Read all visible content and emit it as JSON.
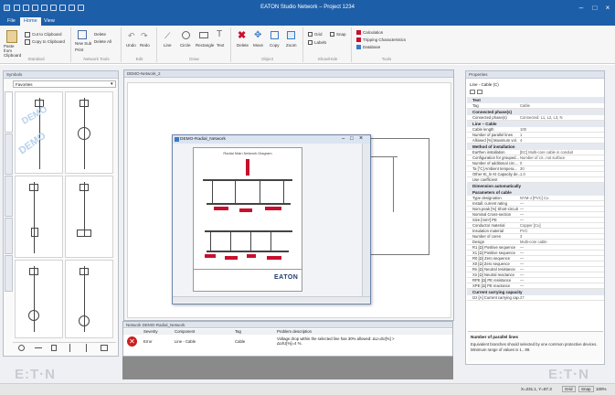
{
  "window": {
    "title": "EATON Studio Network – Project 1234"
  },
  "menu_tabs": [
    "File",
    "Home",
    "View"
  ],
  "ribbon": {
    "groups": [
      {
        "label": "Standard",
        "buttons": [
          "Paste from Clipboard",
          "Cut to Clipboard",
          "Copy to Clipboard"
        ]
      },
      {
        "label": "Network Tools",
        "buttons": [
          "New Sub",
          "Print",
          "Delete",
          "Delete All"
        ]
      },
      {
        "label": "Edit",
        "buttons": [
          "Undo",
          "Redo"
        ]
      },
      {
        "label": "Draw",
        "buttons": [
          "Line",
          "Circle",
          "Rectangle",
          "Text"
        ]
      },
      {
        "label": "Object",
        "buttons": [
          "Delete",
          "Move",
          "Copy",
          "Zoom"
        ]
      },
      {
        "label": "Show/Hide",
        "buttons": [
          "Grid",
          "Snap",
          "Labels"
        ]
      },
      {
        "label": "Tools",
        "buttons": [
          "Calculation",
          "Tripping Characteristics",
          "Database"
        ]
      }
    ]
  },
  "symbols_panel": {
    "title": "Symbols",
    "dropdown": "Favorites",
    "side_tabs": [
      "Favourites",
      "Symbols",
      "Protection",
      "Distribution",
      "Selectivity"
    ]
  },
  "overlays": {
    "demo": "DEMO"
  },
  "watermark": "E:T·N",
  "network_window": {
    "title": "DEMO-Radial_Network",
    "heading": "Radial Main Network Diagram",
    "brand": "EATON"
  },
  "background_window": {
    "title": "DEMO-Network_2"
  },
  "error_panel": {
    "title": "Network DEMO-Radial_Network",
    "columns": [
      "Severity",
      "Component",
      "Tag",
      "Problem description"
    ],
    "rows": [
      {
        "severity": "Error",
        "component": "Line - Cable",
        "tag": "Cable",
        "problem": "Voltage drop within the selected line has 30% allowed: ΔU=dU[%] > ΔU/U[%]=4 %."
      }
    ]
  },
  "properties": {
    "title": "Properties",
    "object": "Line - Cable (C)",
    "categories": [
      {
        "name": "Text",
        "rows": [
          [
            "Tag",
            "Cable"
          ]
        ]
      },
      {
        "name": "Connected phase(s)",
        "rows": [
          [
            "Connected phase(s)",
            "Connected: L1, L2, L3, N"
          ]
        ]
      },
      {
        "name": "Line – Cable",
        "rows": [
          [
            "Cable length",
            "100"
          ],
          [
            "Number of parallel lines",
            "1"
          ],
          [
            "Allowed [%] Maximum vol.",
            "4"
          ]
        ]
      },
      {
        "name": "Method of installation",
        "rows": [
          [
            "Earthen installation",
            "[EC] Multi-core cable in conduit"
          ],
          [
            "Configuration for grouped...",
            "Number of cir...not surface"
          ],
          [
            "Number of additional circ...",
            "0"
          ],
          [
            "Ta [°C] Ambient tempera...",
            "30"
          ],
          [
            "Other Kt_ln Kt Capacity de...",
            "1.0"
          ],
          [
            "Use coefficient",
            ""
          ]
        ]
      },
      {
        "name": "Dimension automatically",
        "rows": []
      },
      {
        "name": "Parameters of cable",
        "rows": [
          [
            "Type designation",
            "NYM-J [PVC] Cu"
          ],
          [
            "Install. current rating",
            "—"
          ],
          [
            "Nom.peak [%] Short-circuit",
            "—"
          ],
          [
            "Nominal Cross-section",
            "—"
          ],
          [
            "Size [mm²] PE",
            "—"
          ],
          [
            "Conductor material",
            "Copper [Cu]"
          ],
          [
            "Insulation material",
            "PVC"
          ],
          [
            "Number of cores",
            "3"
          ],
          [
            "Design",
            "Multi-core cable"
          ],
          [
            "R1 [Ω] Positive sequence",
            "—"
          ],
          [
            "X1 [Ω] Positive sequence",
            "—"
          ],
          [
            "R0 [Ω] Zero sequence",
            "—"
          ],
          [
            "X0 [Ω] Zero sequence",
            "—"
          ],
          [
            "Rn [Ω] Neutral resistance",
            "—"
          ],
          [
            "Xn [Ω] Neutral reactance",
            "—"
          ],
          [
            "RPE [Ω] PE resistance",
            "—"
          ],
          [
            "XPE [Ω] PE reactance",
            "—"
          ]
        ]
      },
      {
        "name": "Current carrying capacity",
        "rows": [
          [
            "Izz [A] Current carrying cap.",
            "27"
          ]
        ]
      }
    ],
    "help_title": "Number of parallel lines",
    "help_text": "Equivalent branches should selected by one common protective devices. Minimum range of values is 1...99."
  },
  "statusbar": {
    "coords": "X=231.1, Y=87.3",
    "mode": "Grid",
    "snap": "Snap",
    "zoom": "100%"
  },
  "colors": {
    "title": "#1d5ea8",
    "accent": "#c8102e",
    "error": "#cc1f1f"
  }
}
